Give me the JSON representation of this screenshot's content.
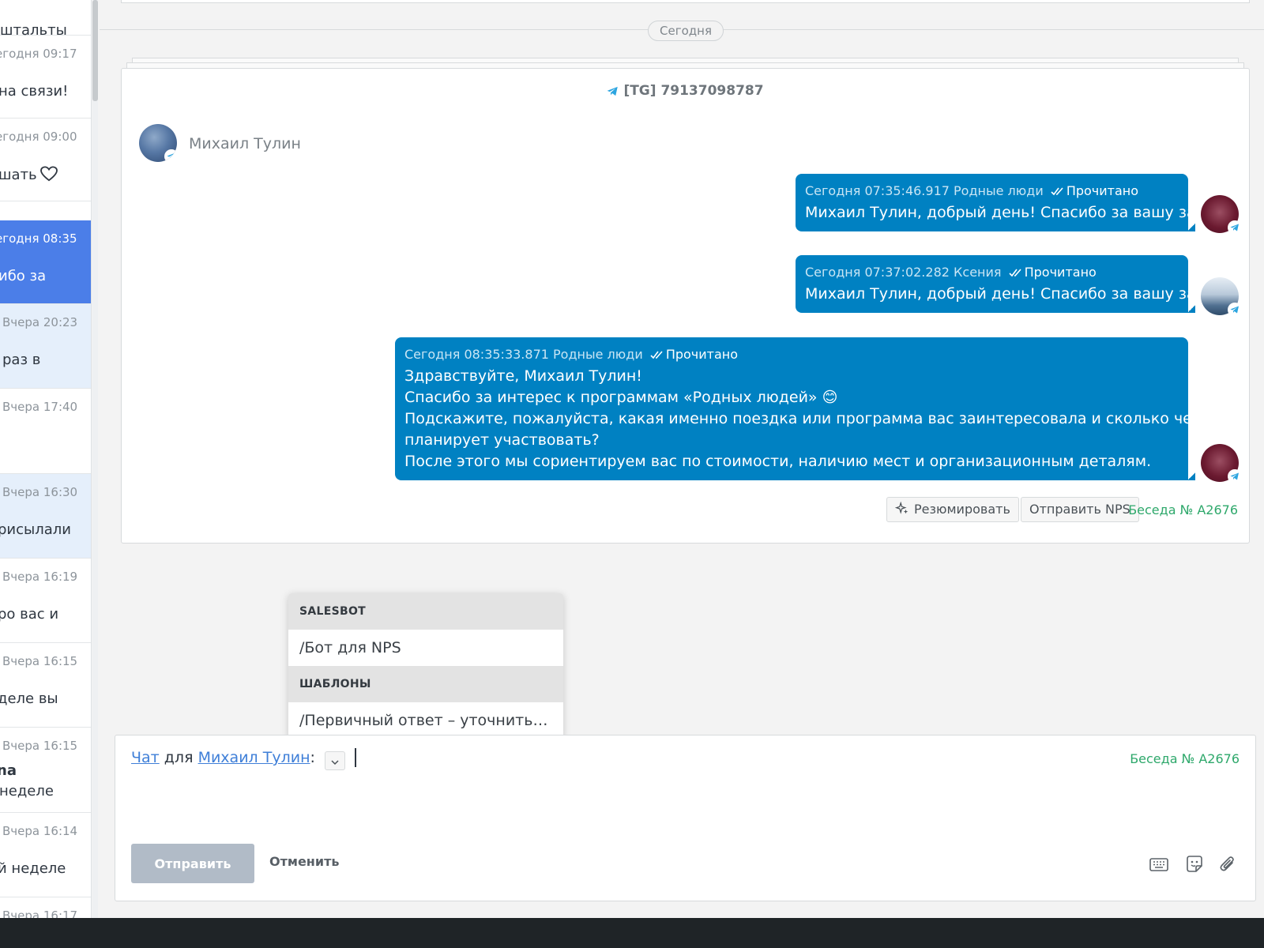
{
  "sidebar": {
    "conversations": [
      {
        "time": "",
        "preview": "штальты",
        "state": "normal"
      },
      {
        "time": "егодня 09:17",
        "preview": "на связи!",
        "state": "normal"
      },
      {
        "time": "егодня 09:00",
        "preview": "шать",
        "state": "normal",
        "icon": "heart-icon"
      },
      {
        "time": "егодня 08:35",
        "preview": "ибо за",
        "state": "active"
      },
      {
        "time": "Вчера 20:23",
        "preview": "раз в",
        "state": "unread"
      },
      {
        "time": "Вчера 17:40",
        "preview": "",
        "state": "normal"
      },
      {
        "time": "Вчера 16:30",
        "preview": "рисылали",
        "state": "unread"
      },
      {
        "time": "Вчера 16:19",
        "preview": "ро вас и",
        "state": "normal"
      },
      {
        "time": "Вчера 16:15",
        "preview": "деле вы",
        "state": "normal"
      },
      {
        "time": "Вчера 16:15",
        "preview_bold": "na",
        "preview": "неделе",
        "state": "normal"
      },
      {
        "time": "Вчера 16:14",
        "preview": "й неделе",
        "state": "normal"
      },
      {
        "time": "Вчера 16:17",
        "preview": "",
        "state": "normal"
      }
    ]
  },
  "feed": {
    "date_separator": "Сегодня",
    "card": {
      "title": "[TG] 79137098787",
      "contact_name": "Михаил Тулин",
      "messages": [
        {
          "timestamp": "Сегодня 07:35:46.917",
          "author": "Родные люди",
          "status": "Прочитано",
          "lines": [
            "Михаил Тулин, добрый день! Спасибо за вашу заявку"
          ],
          "avatar": "org"
        },
        {
          "timestamp": "Сегодня 07:37:02.282",
          "author": "Ксения",
          "status": "Прочитано",
          "lines": [
            "Михаил Тулин, добрый день! Спасибо за вашу заявку"
          ],
          "avatar": "photo"
        },
        {
          "timestamp": "Сегодня 08:35:33.871",
          "author": "Родные люди",
          "status": "Прочитано",
          "lines": [
            "Здравствуйте, Михаил Тулин!",
            "Спасибо за интерес к программам «Родных людей» 😊",
            "Подскажите, пожалуйста, какая именно поездка или программа вас заинтересовала и сколько человек",
            "планирует участвовать?",
            "После этого мы сориентируем вас по стоимости, наличию мест и организационным деталям."
          ],
          "avatar": "org"
        }
      ],
      "summarize_label": "Резюмировать",
      "send_nps_label": "Отправить NPS",
      "conversation_id": "Беседа № A2676"
    }
  },
  "suggestions": {
    "sections": [
      {
        "header": "SALESBOT",
        "items": [
          "/Бот для NPS"
        ]
      },
      {
        "header": "ШАБЛОНЫ",
        "items": [
          "/Первичный ответ – уточнить про..."
        ]
      }
    ]
  },
  "composer": {
    "channel_link": "Чат",
    "for_word": "для",
    "recipient_link": "Михаил Тулин",
    "colon": ":",
    "conversation_id": "Беседа № A2676",
    "send_label": "Отправить",
    "cancel_label": "Отменить",
    "tools": [
      "keyboard-icon",
      "sticker-icon",
      "paperclip-icon"
    ]
  },
  "colors": {
    "bubble": "#0081c2",
    "active_conversation": "#4b7ee8",
    "unread_conversation": "#e5effb",
    "link": "#3f7fd8",
    "conversation_id": "#2ea86b",
    "send_disabled": "#b1bbc7"
  }
}
